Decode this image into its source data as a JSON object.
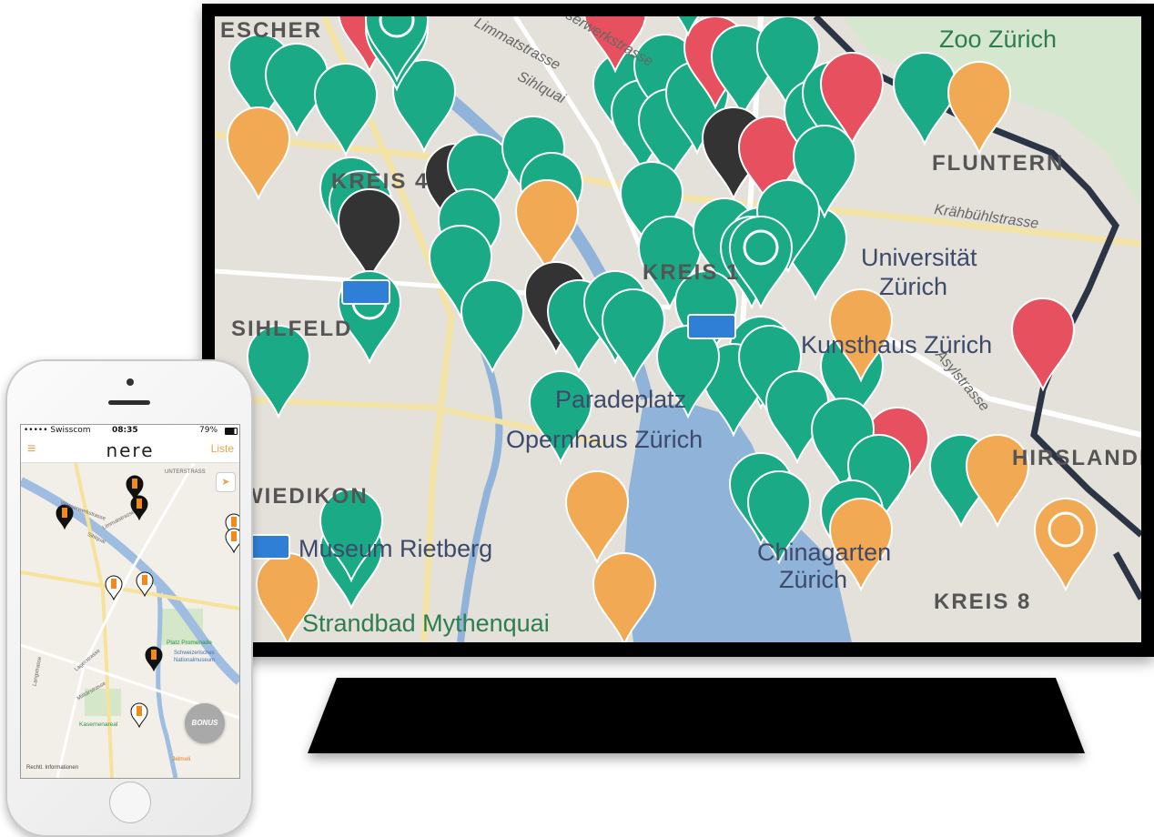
{
  "big_map": {
    "labels": {
      "zoo": "Zoo Zürich",
      "fluntern": "FLUNTERN",
      "kreis4": "KREIS 4",
      "sihlfeld": "SIHLFELD",
      "universitat_line1": "Universität",
      "universitat_line2": "Zürich",
      "kunsthaus": "Kunsthaus Zürich",
      "opernhaus": "Opernhaus Zürich",
      "paradeplatz": "Paradeplatz",
      "wiedikon": "WIEDIKON",
      "rietberg": "Museum Rietberg",
      "chinagarten_line1": "Chinagarten",
      "chinagarten_line2": "Zürich",
      "kreis8": "KREIS 8",
      "mythenquai": "Strandbad Mythenquai",
      "hirslanden": "HIRSLANDEN",
      "kreis1": "KREIS 1",
      "aussersihl": "ESCHER",
      "limmatstrasse": "Limmatstrasse",
      "wasserwerkstrasse": "Wasserwerkstrasse",
      "sihlquai": "Sihlquai",
      "krahbuhlstrasse": "Krähbühlstrasse",
      "asylstrasse": "Asylstrasse"
    },
    "colors": {
      "green": "#1aab86",
      "orange": "#f2a953",
      "red": "#e7505f",
      "dark": "#333333",
      "blue": "#2f7fd6",
      "lake": "#8fb3d9",
      "boundary": "#2b3545"
    }
  },
  "phone": {
    "status": {
      "carrier": "••••• Swisscom",
      "time": "08:35",
      "battery": "79%"
    },
    "header": {
      "menu_icon": "≡",
      "logo": "nere",
      "list_label": "Liste"
    },
    "map_labels": {
      "unterstrass": "UNTERSTRASS",
      "limmatstrasse": "Limmatstrasse",
      "wasserwerkstrasse": "Wasserwerkstrasse",
      "sihlquai": "Sihlquai",
      "platz_promenade": "Platz Promenade",
      "museum_line1": "Schweizerisches",
      "museum_line2": "Nationalmuseum",
      "kasernenareal": "Kasernenareal",
      "jelmoli": "Jelmoli",
      "langstrasse": "Langstrasse",
      "militarstrasse": "Militärstrasse",
      "lagerstrasse": "Lagerstrasse"
    },
    "bonus_label": "BONUS",
    "legal_link": "Rechtl. Informationen",
    "locate_icon": "navigation-arrow-icon"
  }
}
